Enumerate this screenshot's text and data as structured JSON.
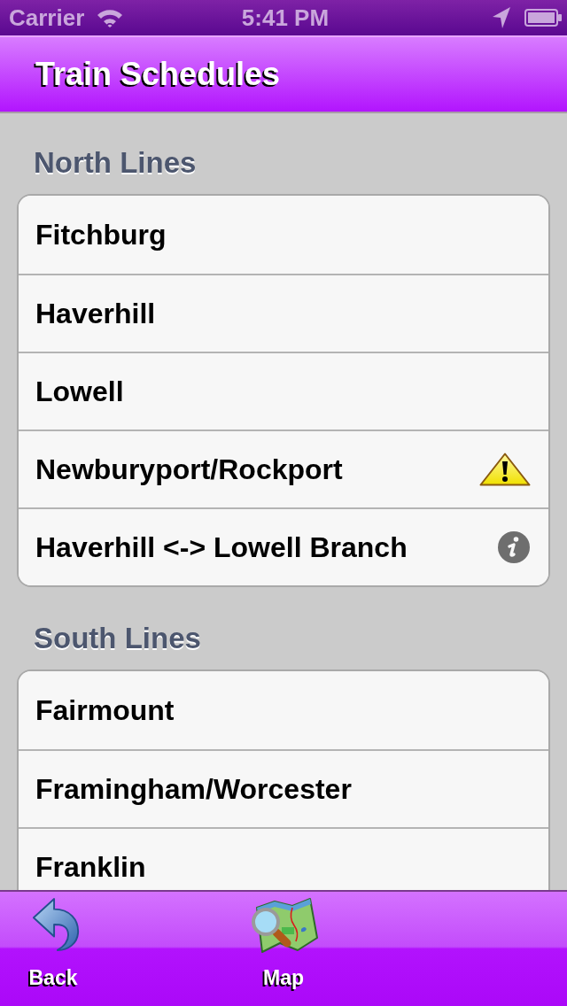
{
  "status_bar": {
    "carrier": "Carrier",
    "time": "5:41 PM"
  },
  "nav_bar": {
    "title": "Train Schedules"
  },
  "sections": [
    {
      "title": "North Lines",
      "rows": [
        {
          "label": "Fitchburg",
          "kind": "plain"
        },
        {
          "label": "Haverhill",
          "kind": "plain"
        },
        {
          "label": "Lowell",
          "kind": "plain"
        },
        {
          "label": "Newburyport/Rockport",
          "kind": "warning"
        },
        {
          "label": "Haverhill <-> Lowell Branch",
          "kind": "info"
        }
      ]
    },
    {
      "title": "South Lines",
      "rows": [
        {
          "label": "Fairmount",
          "kind": "plain"
        },
        {
          "label": "Framingham/Worcester",
          "kind": "plain"
        },
        {
          "label": "Franklin",
          "kind": "plain"
        }
      ]
    }
  ],
  "tab_bar": {
    "items": [
      {
        "label": "Back",
        "kind": "back"
      },
      {
        "label": "Map",
        "kind": "map"
      }
    ]
  }
}
